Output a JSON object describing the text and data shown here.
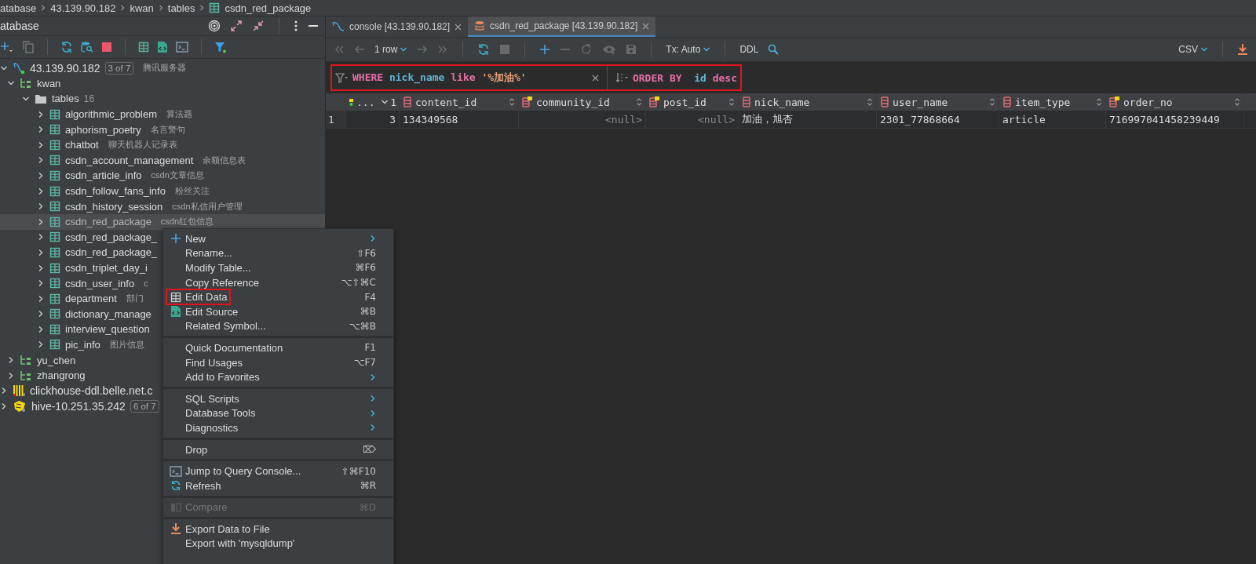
{
  "breadcrumb": [
    "atabase",
    "43.139.90.182",
    "kwan",
    "tables",
    "csdn_red_package"
  ],
  "database_panel": {
    "title": "atabase",
    "tree": [
      {
        "kind": "server",
        "label": "43.139.90.182",
        "badge": "3 of 7",
        "comment": "腾讯服务器",
        "expanded": true,
        "children": [
          {
            "kind": "schema",
            "label": "kwan",
            "expanded": true,
            "children": [
              {
                "kind": "folder",
                "label": "tables",
                "count": "16",
                "expanded": true,
                "children": [
                  {
                    "kind": "table",
                    "label": "algorithmic_problem",
                    "comment": "算法题",
                    "expanded": false,
                    "selected": false
                  },
                  {
                    "kind": "table",
                    "label": "aphorism_poetry",
                    "comment": "名言警句",
                    "expanded": false,
                    "selected": false
                  },
                  {
                    "kind": "table",
                    "label": "chatbot",
                    "comment": "聊天机器人记录表",
                    "expanded": false,
                    "selected": false
                  },
                  {
                    "kind": "table",
                    "label": "csdn_account_management",
                    "comment": "余额信息表",
                    "expanded": false,
                    "selected": false
                  },
                  {
                    "kind": "table",
                    "label": "csdn_article_info",
                    "comment": "csdn文章信息",
                    "expanded": false,
                    "selected": false
                  },
                  {
                    "kind": "table",
                    "label": "csdn_follow_fans_info",
                    "comment": "粉丝关注",
                    "expanded": false,
                    "selected": false
                  },
                  {
                    "kind": "table",
                    "label": "csdn_history_session",
                    "comment": "csdn私信用户管理",
                    "expanded": false,
                    "selected": false
                  },
                  {
                    "kind": "table",
                    "label": "csdn_red_package",
                    "comment": "csdn红包信息",
                    "expanded": false,
                    "selected": true
                  },
                  {
                    "kind": "table",
                    "label": "csdn_red_package_",
                    "expanded": false,
                    "selected": false
                  },
                  {
                    "kind": "table",
                    "label": "csdn_red_package_",
                    "expanded": false,
                    "selected": false
                  },
                  {
                    "kind": "table",
                    "label": "csdn_triplet_day_i",
                    "expanded": false,
                    "selected": false
                  },
                  {
                    "kind": "table",
                    "label": "csdn_user_info",
                    "comment": "c",
                    "expanded": false,
                    "selected": false
                  },
                  {
                    "kind": "table",
                    "label": "department",
                    "comment": "部门",
                    "expanded": false,
                    "selected": false
                  },
                  {
                    "kind": "table",
                    "label": "dictionary_manage",
                    "expanded": false,
                    "selected": false
                  },
                  {
                    "kind": "table",
                    "label": "interview_question",
                    "expanded": false,
                    "selected": false
                  },
                  {
                    "kind": "table",
                    "label": "pic_info",
                    "comment": "图片信息",
                    "expanded": false,
                    "selected": false
                  }
                ]
              }
            ]
          },
          {
            "kind": "schema",
            "label": "yu_chen",
            "expanded": false
          },
          {
            "kind": "schema",
            "label": "zhangrong",
            "expanded": false
          }
        ]
      },
      {
        "kind": "clickhouse",
        "label": "clickhouse-ddl.belle.net.c",
        "expanded": false
      },
      {
        "kind": "hive",
        "label": "hive-10.251.35.242",
        "badge": "6 of 7",
        "expanded": false
      }
    ]
  },
  "context_menu": [
    {
      "kind": "item",
      "label": "New",
      "submenu": true
    },
    {
      "kind": "item",
      "label": "Rename...",
      "shortcut": "⇧F6"
    },
    {
      "kind": "item",
      "label": "Modify Table...",
      "shortcut": "⌘F6"
    },
    {
      "kind": "item",
      "label": "Copy Reference",
      "shortcut": "⌥⇧⌘C"
    },
    {
      "kind": "item",
      "label": "Edit Data",
      "shortcut": "F4",
      "outlined": true
    },
    {
      "kind": "item",
      "label": "Edit Source",
      "shortcut": "⌘B"
    },
    {
      "kind": "item",
      "label": "Related Symbol...",
      "shortcut": "⌥⌘B"
    },
    {
      "kind": "separator"
    },
    {
      "kind": "item",
      "label": "Quick Documentation",
      "shortcut": "F1"
    },
    {
      "kind": "item",
      "label": "Find Usages",
      "shortcut": "⌥F7"
    },
    {
      "kind": "item",
      "label": "Add to Favorites",
      "submenu": true
    },
    {
      "kind": "separator"
    },
    {
      "kind": "item",
      "label": "SQL Scripts",
      "submenu": true
    },
    {
      "kind": "item",
      "label": "Database Tools",
      "submenu": true
    },
    {
      "kind": "item",
      "label": "Diagnostics",
      "submenu": true
    },
    {
      "kind": "separator"
    },
    {
      "kind": "item",
      "label": "Drop",
      "shortcut": "⌦"
    },
    {
      "kind": "separator"
    },
    {
      "kind": "item",
      "label": "Jump to Query Console...",
      "shortcut": "⇧⌘F10"
    },
    {
      "kind": "item",
      "label": "Refresh",
      "shortcut": "⌘R"
    },
    {
      "kind": "separator"
    },
    {
      "kind": "item",
      "label": "Compare",
      "shortcut": "⌘D",
      "disabled": true
    },
    {
      "kind": "separator"
    },
    {
      "kind": "item",
      "label": "Export Data to File"
    },
    {
      "kind": "item",
      "label": "Export with 'mysqldump'"
    }
  ],
  "tabs": [
    {
      "label": "console [43.139.90.182]",
      "selected": false
    },
    {
      "label": "csdn_red_package [43.139.90.182]",
      "selected": true
    }
  ],
  "toolbar": {
    "rows": "1 row",
    "tx": "Tx: Auto",
    "ddl": "DDL",
    "format": "CSV"
  },
  "filter": {
    "where_keyword": "WHERE",
    "where_column": "nick_name",
    "where_operator": "like",
    "where_value": "'%加油%'",
    "order_keyword": "ORDER BY",
    "order_column": "id",
    "order_direction": "desc",
    "outlined": true
  },
  "table": {
    "columns": [
      {
        "name": "...",
        "kind": "collapsed",
        "sort_order": "1"
      },
      {
        "name": "content_id",
        "kind": "column"
      },
      {
        "name": "community_id",
        "kind": "indexed"
      },
      {
        "name": "post_id",
        "kind": "indexed"
      },
      {
        "name": "nick_name",
        "kind": "column"
      },
      {
        "name": "user_name",
        "kind": "column"
      },
      {
        "name": "item_type",
        "kind": "column"
      },
      {
        "name": "order_no",
        "kind": "indexed"
      }
    ],
    "rows": [
      {
        "number": "1",
        "cells": [
          {
            "text": "3",
            "null": false
          },
          {
            "text": "134349568",
            "null": false
          },
          {
            "text": "<null>",
            "null": true
          },
          {
            "text": "<null>",
            "null": true
          },
          {
            "text": "加油，旭杏",
            "null": false
          },
          {
            "text": "2301_77868664",
            "null": false
          },
          {
            "text": "article",
            "null": false
          },
          {
            "text": "716997041458239449",
            "null": false
          }
        ]
      }
    ]
  }
}
